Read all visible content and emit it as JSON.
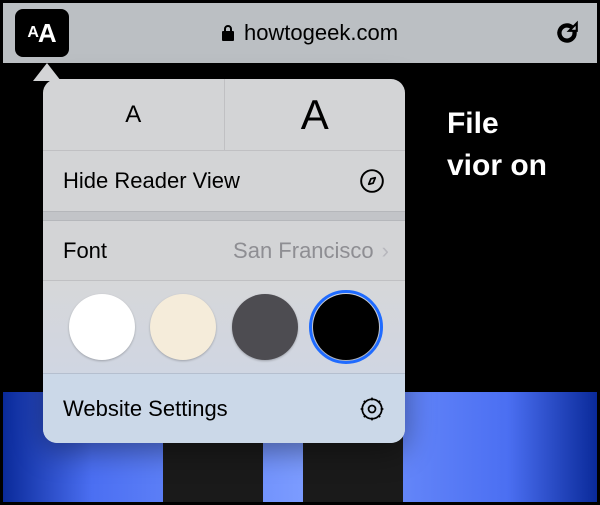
{
  "address_bar": {
    "domain": "howtogeek.com"
  },
  "page": {
    "headline_line1": "File",
    "headline_line2": "vior on"
  },
  "popover": {
    "decrease_label": "A",
    "increase_label": "A",
    "reader_label": "Hide Reader View",
    "font_label": "Font",
    "font_value": "San Francisco",
    "settings_label": "Website Settings",
    "themes": [
      {
        "name": "white",
        "hex": "#ffffff",
        "selected": false
      },
      {
        "name": "sepia",
        "hex": "#f5ecda",
        "selected": false
      },
      {
        "name": "gray",
        "hex": "#4d4c51",
        "selected": false
      },
      {
        "name": "black",
        "hex": "#000000",
        "selected": true
      }
    ]
  },
  "colors": {
    "accent": "#1f6bff"
  }
}
